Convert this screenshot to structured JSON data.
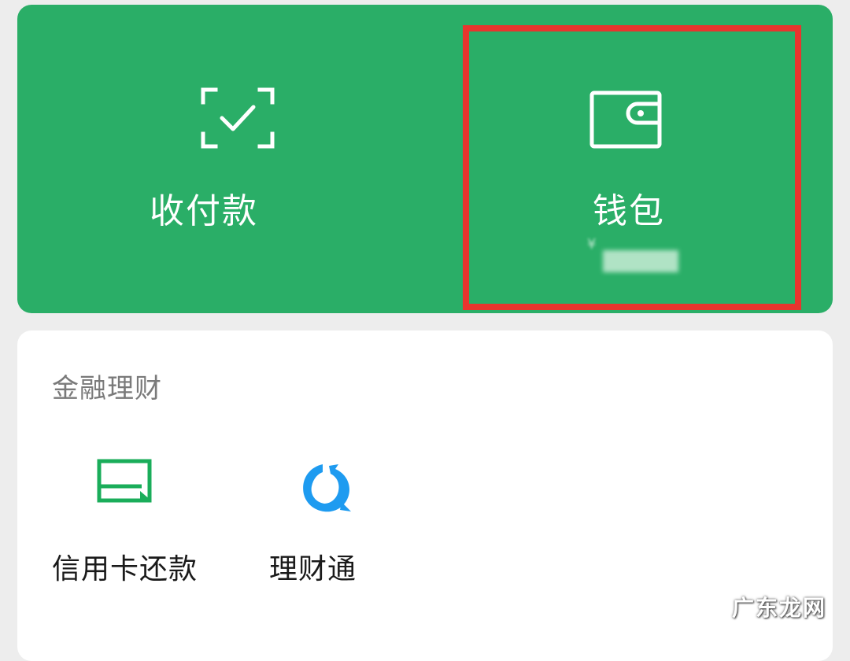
{
  "top_panel": {
    "pay": {
      "label": "收付款",
      "icon": "scan-check-icon"
    },
    "wallet": {
      "label": "钱包",
      "icon": "wallet-icon",
      "balance_symbol": "¥"
    }
  },
  "finance": {
    "title": "金融理财",
    "items": [
      {
        "label": "信用卡还款",
        "icon": "credit-card-repay-icon"
      },
      {
        "label": "理财通",
        "icon": "licaitong-icon"
      }
    ]
  },
  "watermark": "广东龙网",
  "colors": {
    "brand_green": "#2aae67",
    "highlight_red": "#e8352e",
    "licaitong_blue": "#1e9bf0",
    "background": "#ededed"
  }
}
